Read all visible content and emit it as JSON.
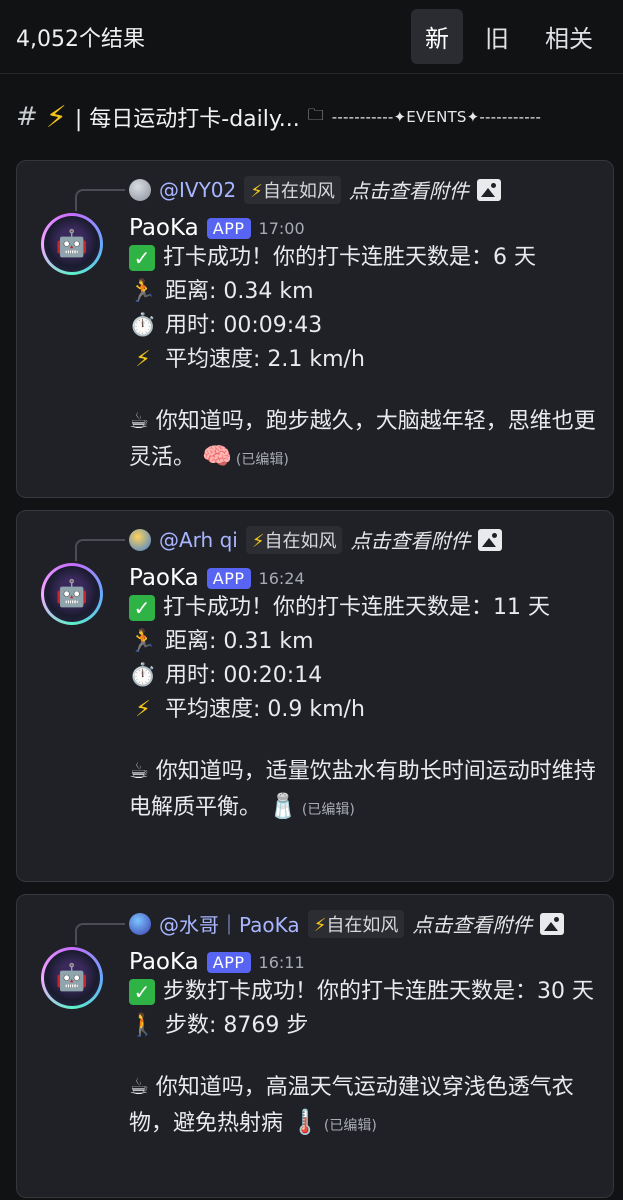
{
  "header": {
    "result_count": "4,052个结果",
    "sort_tabs": [
      {
        "label": "新",
        "active": true
      },
      {
        "label": "旧",
        "active": false
      },
      {
        "label": "相关",
        "active": false
      }
    ]
  },
  "channel": {
    "hash": "#",
    "name": "| 每日运动打卡-daily...",
    "subtitle": "-----------✦EVENTS✦-----------"
  },
  "messages": [
    {
      "reply_user": "@IVY02",
      "reply_tag": "自在如风",
      "reply_link": "点击查看附件",
      "author": "PaoKa",
      "badge": "APP",
      "time": "17:00",
      "success": "打卡成功！你的打卡连胜天数是：6 天",
      "distance": "距离: 0.34 km",
      "duration": "用时: 00:09:43",
      "speed": "平均速度: 2.1 km/h",
      "tip": "你知道吗，跑步越久，大脑越年轻，思维也更灵活。",
      "tip_emoji": "🧠",
      "edited": "(已编辑)"
    },
    {
      "reply_user": "@Arh qi",
      "reply_tag": "自在如风",
      "reply_link": "点击查看附件",
      "author": "PaoKa",
      "badge": "APP",
      "time": "16:24",
      "success": "打卡成功！你的打卡连胜天数是：11 天",
      "distance": "距离: 0.31 km",
      "duration": "用时: 00:20:14",
      "speed": "平均速度: 0.9 km/h",
      "tip": "你知道吗，适量饮盐水有助长时间运动时维持电解质平衡。",
      "tip_emoji": "🧂",
      "edited": "(已编辑)"
    },
    {
      "reply_user": "@水哥｜PaoKa",
      "reply_tag": "自在如风",
      "reply_link": "点击查看附件",
      "author": "PaoKa",
      "badge": "APP",
      "time": "16:11",
      "success": "步数打卡成功！你的打卡连胜天数是：30 天",
      "steps": "步数: 8769 步",
      "tip": "你知道吗，高温天气运动建议穿浅色透气衣物，避免热射病",
      "tip_emoji": "🌡️",
      "edited": "(已编辑)"
    }
  ],
  "icons": {
    "check": "check-icon",
    "runner": "runner-icon",
    "stopwatch": "stopwatch-icon",
    "lightning": "lightning-icon",
    "coffee": "coffee-icon",
    "walker": "walker-icon",
    "image": "image-icon",
    "folder": "folder-icon"
  },
  "colors": {
    "background": "#111214",
    "card": "#1f2126",
    "app_badge": "#5865f2",
    "mention": "#a9b6ff",
    "check": "#2fb344"
  }
}
